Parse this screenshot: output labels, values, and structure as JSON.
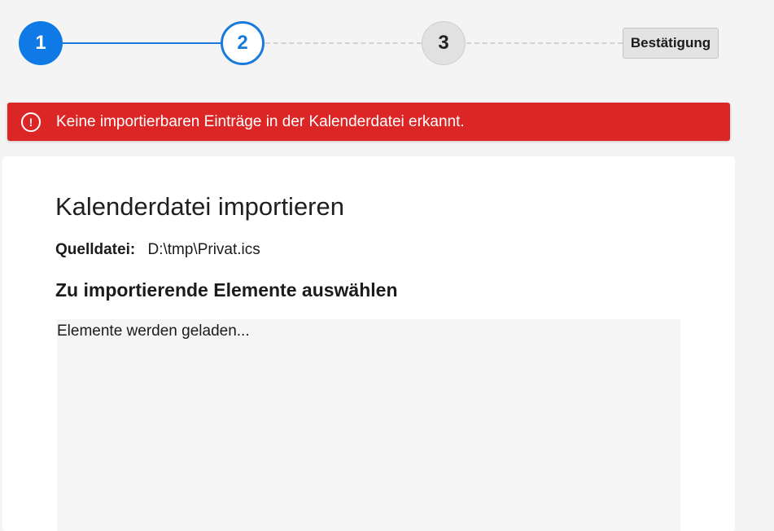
{
  "stepper": {
    "steps": [
      {
        "label": "1",
        "state": "completed",
        "color": "#0f7ae5"
      },
      {
        "label": "2",
        "state": "current",
        "color": "#1a7ad9"
      },
      {
        "label": "3",
        "state": "upcoming",
        "color": "#e1e1e1"
      }
    ],
    "confirm_label": "Bestätigung"
  },
  "error": {
    "icon": "error-exclamation-icon",
    "message": "Keine importierbaren Einträge in der Kalenderdatei erkannt.",
    "color": "#dc2626"
  },
  "main": {
    "title": "Kalenderdatei importieren",
    "source_label": "Quelldatei:",
    "source_value": "D:\\tmp\\Privat.ics",
    "section_heading": "Zu importierende Elemente auswählen",
    "loading_text": "Elemente werden geladen..."
  }
}
